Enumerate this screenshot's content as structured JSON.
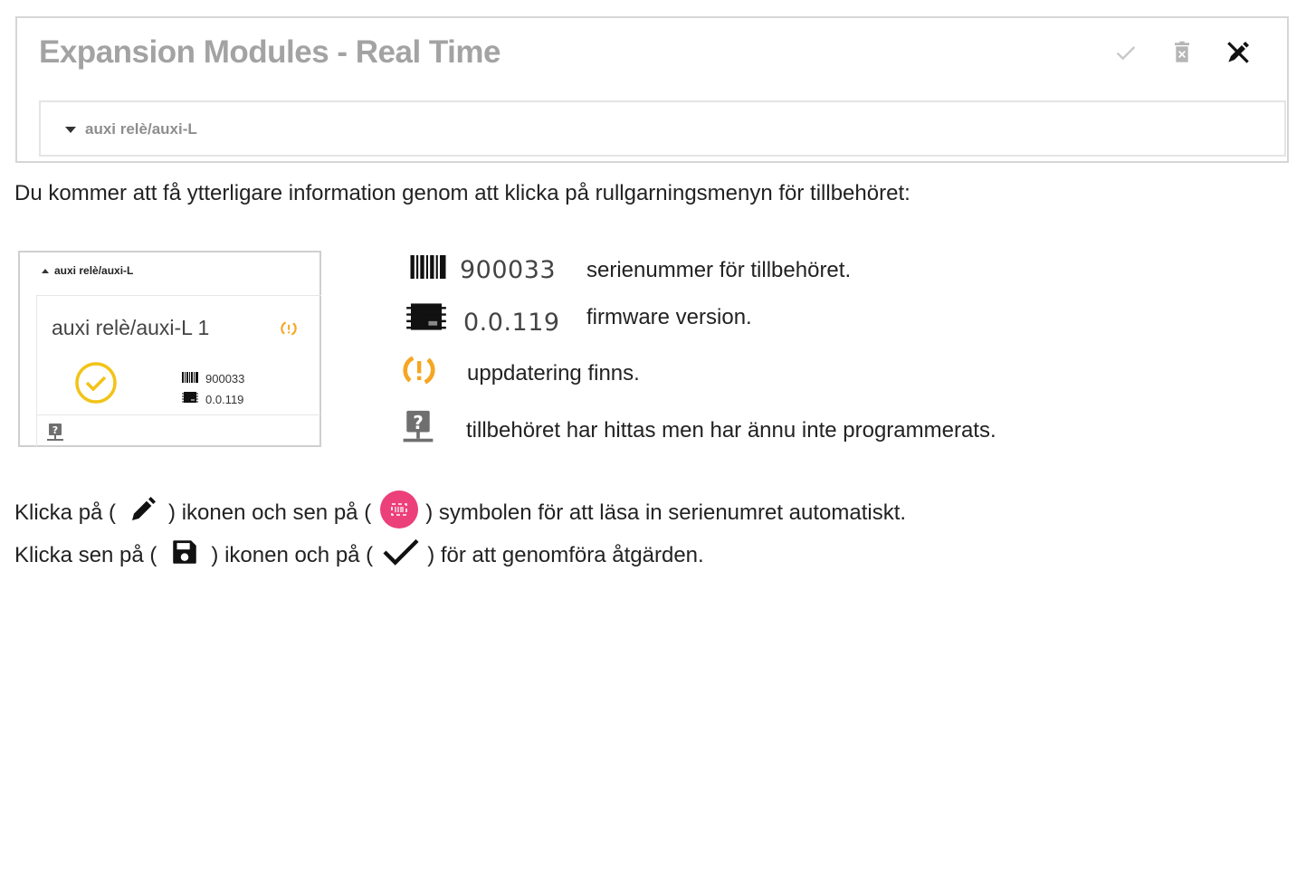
{
  "panel": {
    "title": "Expansion Modules - Real Time",
    "accessory_label": "auxi relè/auxi-L",
    "actions": [
      "check-icon",
      "trash-icon",
      "edit-off-icon"
    ]
  },
  "intro_text": "Du kommer att få ytterligare information genom att klicka på rullgarningsmenyn för tillbehöret:",
  "card": {
    "header": "auxi relè/auxi-L",
    "title": "auxi relè/auxi-L 1",
    "serial": "900033",
    "firmware": "0.0.119",
    "status_color": "#f2c318",
    "update_color": "#f5a623"
  },
  "legend": {
    "serial_value": "900033",
    "serial_desc": "serienummer för tillbehöret.",
    "firmware_value": "0.0.119",
    "firmware_desc": "firmware version.",
    "update_desc": "uppdatering finns.",
    "unprogrammed_desc": "tillbehöret har hittas men har ännu inte programmerats."
  },
  "instructions": {
    "line1_a": "Klicka på (",
    "line1_b": ") ikonen och sen på (",
    "line1_c": ") symbolen för att läsa in serienumret  automatiskt.",
    "line2_a": "Klicka sen på (",
    "line2_b": ") ikonen och på (",
    "line2_c": ") för att genomföra åtgärden.",
    "scan_button_color": "#ec407a"
  }
}
